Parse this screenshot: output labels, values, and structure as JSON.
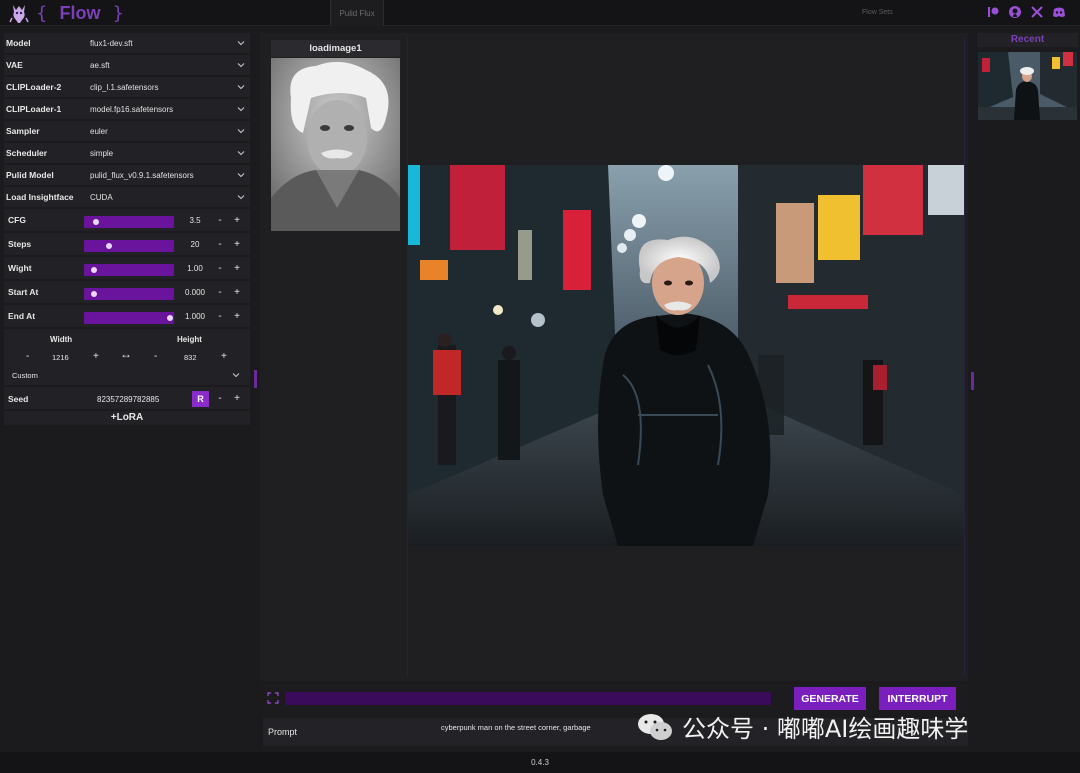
{
  "header": {
    "brace_open": "{",
    "app_name": "Flow",
    "brace_close": "}",
    "tab_label": "Pulid Flux",
    "flowset_label": "Flow Sets",
    "accent_color": "#7b3fb8"
  },
  "sidebar": {
    "selects": [
      {
        "label": "Model",
        "value": "flux1-dev.sft"
      },
      {
        "label": "VAE",
        "value": "ae.sft"
      },
      {
        "label": "CLIPLoader-2",
        "value": "clip_l.1.safetensors"
      },
      {
        "label": "CLIPLoader-1",
        "value": "model.fp16.safetensors"
      },
      {
        "label": "Sampler",
        "value": "euler"
      },
      {
        "label": "Scheduler",
        "value": "simple"
      },
      {
        "label": "Pulid Model",
        "value": "pulid_flux_v0.9.1.safetensors"
      },
      {
        "label": "Load Insightface",
        "value": "CUDA"
      }
    ],
    "sliders": [
      {
        "label": "CFG",
        "value": "3.5",
        "position": 0.08
      },
      {
        "label": "Steps",
        "value": "20",
        "position": 0.24
      },
      {
        "label": "Wight",
        "value": "1.00",
        "position": 0.06
      },
      {
        "label": "Start At",
        "value": "0.000",
        "position": 0.06
      },
      {
        "label": "End At",
        "value": "1.000",
        "position": 0.96
      }
    ],
    "minus": "-",
    "plus": "+",
    "dims": {
      "width_label": "Width",
      "width_value": "1216",
      "height_label": "Height",
      "height_value": "832",
      "swap": "↔",
      "preset": "Custom"
    },
    "seed": {
      "label": "Seed",
      "value": "82357289782885",
      "random_label": "R"
    },
    "lora_label": "+LoRA"
  },
  "loadimage": {
    "title": "loadimage1"
  },
  "recent": {
    "title": "Recent"
  },
  "controls": {
    "generate_label": "GENERATE",
    "interrupt_label": "INTERRUPT",
    "prompt_label": "Prompt",
    "prompt_value": "cyberpunk man on the street corner, garbage"
  },
  "watermark": {
    "text": "公众号 · 嘟嘟AI绘画趣味学"
  },
  "footer": {
    "version": "0.4.3"
  }
}
